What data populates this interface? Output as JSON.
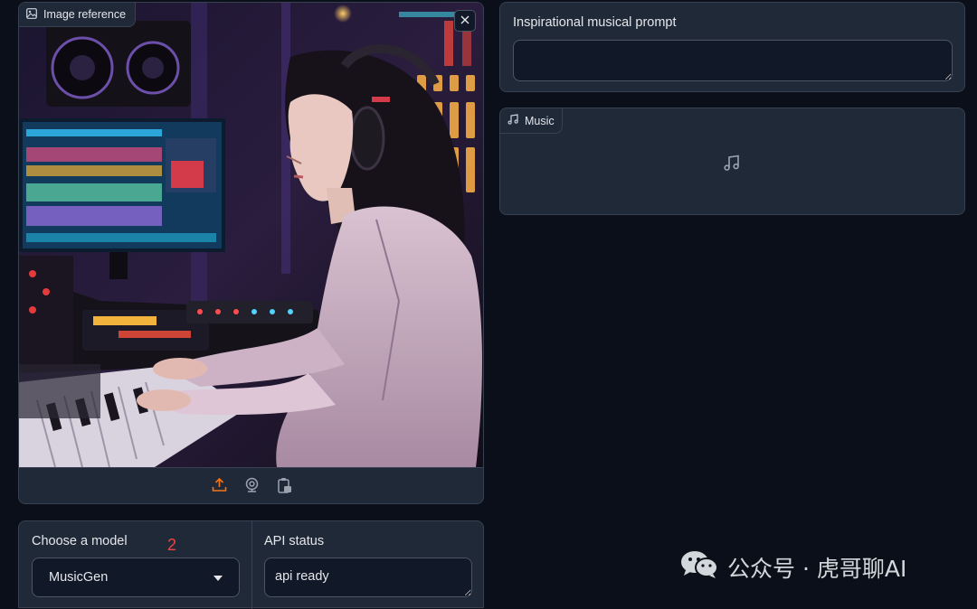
{
  "image_panel": {
    "label": "Image reference",
    "label_icon": "image-icon",
    "close_icon": "close-icon",
    "toolbar_icons": [
      "upload-icon",
      "webcam-icon",
      "clipboard-icon"
    ],
    "toolbar_accent_color": "#f97316"
  },
  "prompt_panel": {
    "label": "Inspirational musical prompt",
    "value": ""
  },
  "music_panel": {
    "label": "Music",
    "label_icon": "music-note-icon"
  },
  "model_panel": {
    "label": "Choose a model",
    "annotation_number": "2",
    "selected_model": "MusicGen"
  },
  "api_panel": {
    "label": "API status",
    "value": "api ready"
  },
  "watermark": {
    "text": "公众号 · 虎哥聊AI",
    "icon": "wechat-icon"
  },
  "colors": {
    "background": "#0b0f19",
    "panel": "#1f2937",
    "border": "#374151",
    "annotation_red": "#ef4444"
  }
}
